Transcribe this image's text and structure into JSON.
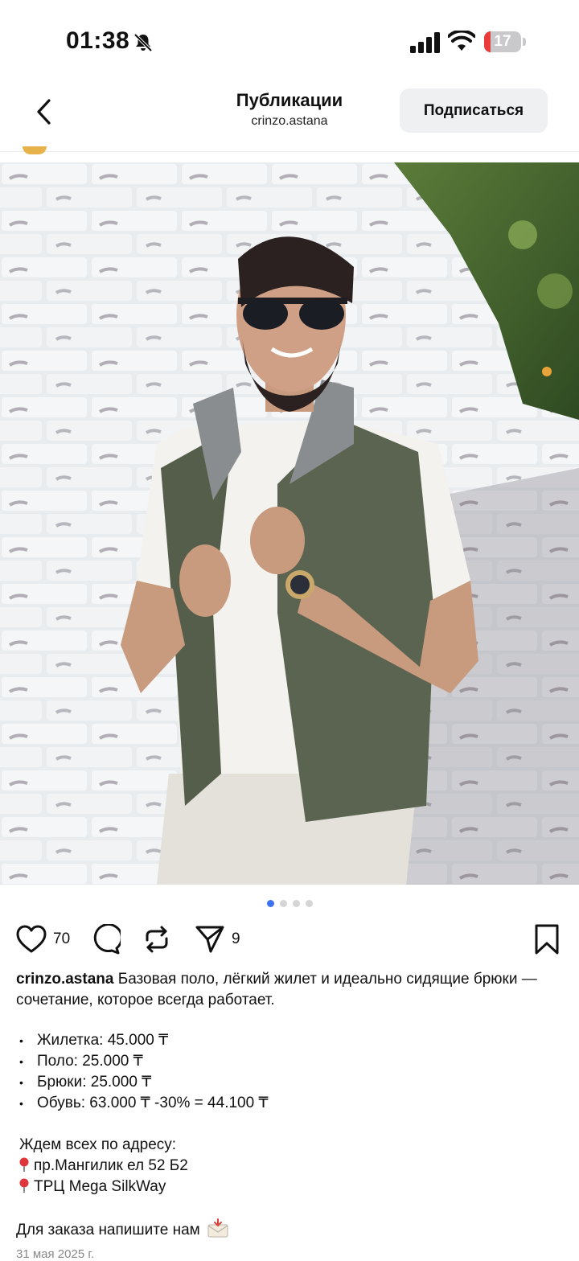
{
  "status_bar": {
    "time": "01:38",
    "battery": "17",
    "battery_level": 0.17
  },
  "header": {
    "title": "Публикации",
    "subtitle": "crinzo.astana",
    "subscribe_label": "Подписаться"
  },
  "post": {
    "carousel": {
      "count": 4,
      "active": 0
    },
    "likes": "70",
    "shares": "9",
    "caption": {
      "username": "crinzo.astana",
      "text": "Базовая поло, лёгкий жилет и идеально сидящие брюки — сочетание, которое всегда работает.",
      "prices": [
        "Жилетка: 45.000 ₸",
        "Поло: 25.000 ₸",
        "Брюки: 25.000 ₸",
        "Обувь: 63.000 ₸ -30% = 44.100 ₸"
      ],
      "address_intro": "Ждем всех по адресу:",
      "addresses": [
        "пр.Мангилик ел 52 Б2",
        "ТРЦ Mega SilkWay"
      ],
      "order_text": "Для заказа напишите нам"
    },
    "date": "31 мая 2025 г."
  },
  "icons": {
    "back": "chevron-left-icon",
    "bell": "bell-slash-icon",
    "like": "heart-icon",
    "comment": "speech-bubble-icon",
    "repost": "repost-icon",
    "share": "paper-plane-icon",
    "save": "bookmark-icon",
    "pin": "pin-icon",
    "mail": "envelope-icon"
  },
  "colors": {
    "accent": "#3d73f0",
    "battery_low": "#eb3a3a",
    "button_bg": "#eef0f2"
  }
}
